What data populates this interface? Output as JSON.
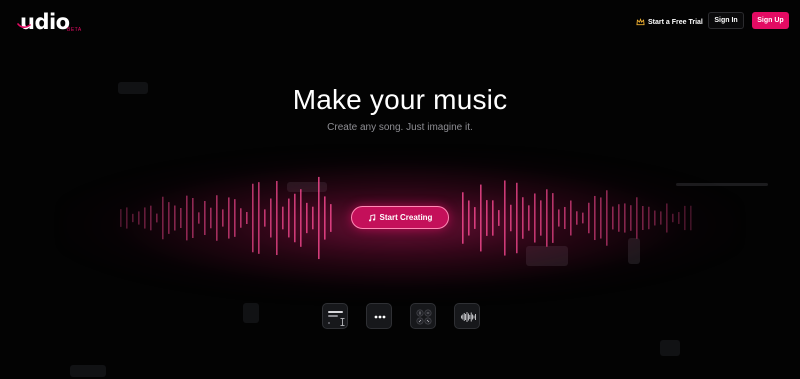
{
  "brand": {
    "name": "udio",
    "badge": "BETA",
    "accent": "#e30b63"
  },
  "header": {
    "trial_label": "Start a Free Trial",
    "signin_label": "Sign In",
    "signup_label": "Sign Up"
  },
  "hero": {
    "title": "Make your music",
    "subtitle": "Create any song. Just imagine it.",
    "cta_label": "Start Creating"
  },
  "icons": {
    "crown": "crown-icon",
    "music_note": "music-note-icon",
    "text_prompt": "text-prompt-icon",
    "more": "more-icon",
    "controls": "controls-icon",
    "waveform": "waveform-icon",
    "text_cursor": "text-cursor-icon"
  },
  "colors": {
    "background": "#030303",
    "glow": "#c4105a",
    "button_border": "#ff8ab5"
  }
}
